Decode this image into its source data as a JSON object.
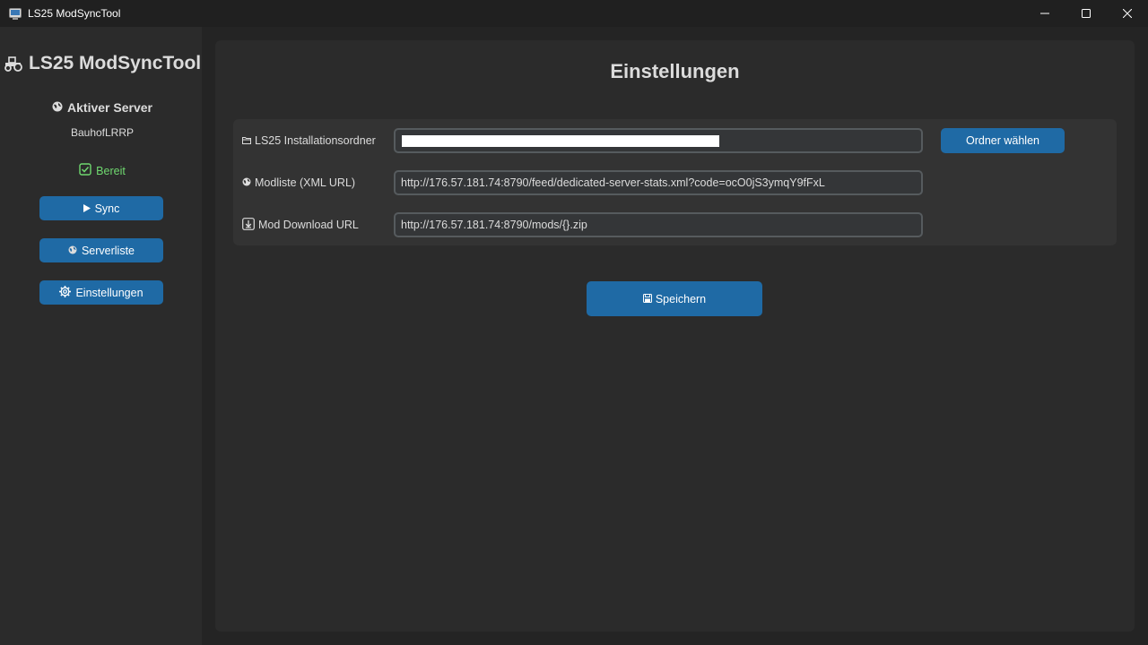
{
  "window": {
    "title": "LS25 ModSyncTool",
    "icons": {
      "app": "app-window-icon",
      "minimize": "minimize-icon",
      "maximize": "maximize-icon",
      "close": "close-icon"
    }
  },
  "sidebar": {
    "app_title": "LS25 ModSyncTool",
    "app_icon": "tractor-icon",
    "server_heading": "Aktiver Server",
    "server_heading_icon": "server-globe-icon",
    "server_name": "BauhofLRRP",
    "status_text": "Bereit",
    "status_icon": "checkbox-check-icon",
    "status_color": "#6fd86f",
    "buttons": [
      {
        "label": "Sync",
        "icon": "play-icon"
      },
      {
        "label": "Serverliste",
        "icon": "globe-icon"
      },
      {
        "label": "Einstellungen",
        "icon": "gear-icon"
      }
    ]
  },
  "main": {
    "title": "Einstellungen",
    "fields": [
      {
        "label": "LS25 Installationsordner",
        "icon": "folder-icon",
        "value": ""
      },
      {
        "label": "Modliste (XML URL)",
        "icon": "globe-icon",
        "value": "http://176.57.181.74:8790/feed/dedicated-server-stats.xml?code=ocO0jS3ymqY9fFxL"
      },
      {
        "label": "Mod Download URL",
        "icon": "download-icon",
        "value": "http://176.57.181.74:8790/mods/{}.zip"
      }
    ],
    "choose_folder_label": "Ordner wählen",
    "save_label": "Speichern",
    "save_icon": "floppy-disk-icon"
  },
  "colors": {
    "accent": "#1f6aa5",
    "background": "#242424",
    "sidebar": "#2b2b2b",
    "panel": "#333333",
    "input_bg": "#343638",
    "input_border": "#565b5e"
  }
}
